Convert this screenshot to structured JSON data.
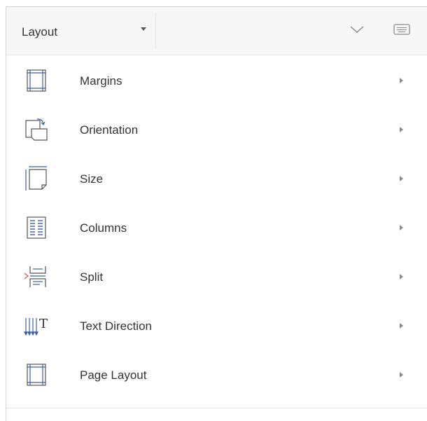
{
  "ribbon": {
    "active_tab": "Layout",
    "tab_dropdown_icon": "caret-down-icon",
    "collapse_icon": "chevron-down-icon",
    "keyboard_icon": "keyboard-icon"
  },
  "menu": {
    "items": [
      {
        "label": "Margins",
        "icon": "margins-icon"
      },
      {
        "label": "Orientation",
        "icon": "orientation-icon"
      },
      {
        "label": "Size",
        "icon": "size-icon"
      },
      {
        "label": "Columns",
        "icon": "columns-icon"
      },
      {
        "label": "Split",
        "icon": "split-icon"
      },
      {
        "label": "Text Direction",
        "icon": "text-direction-icon"
      },
      {
        "label": "Page Layout",
        "icon": "page-layout-icon"
      }
    ],
    "submenu_icon": "chevron-right-icon"
  },
  "colors": {
    "icon_blue": "#3b5ea8",
    "icon_gray": "#6b6b6b",
    "accent_red": "#d9534f",
    "header_bg": "#f7f7f7"
  }
}
